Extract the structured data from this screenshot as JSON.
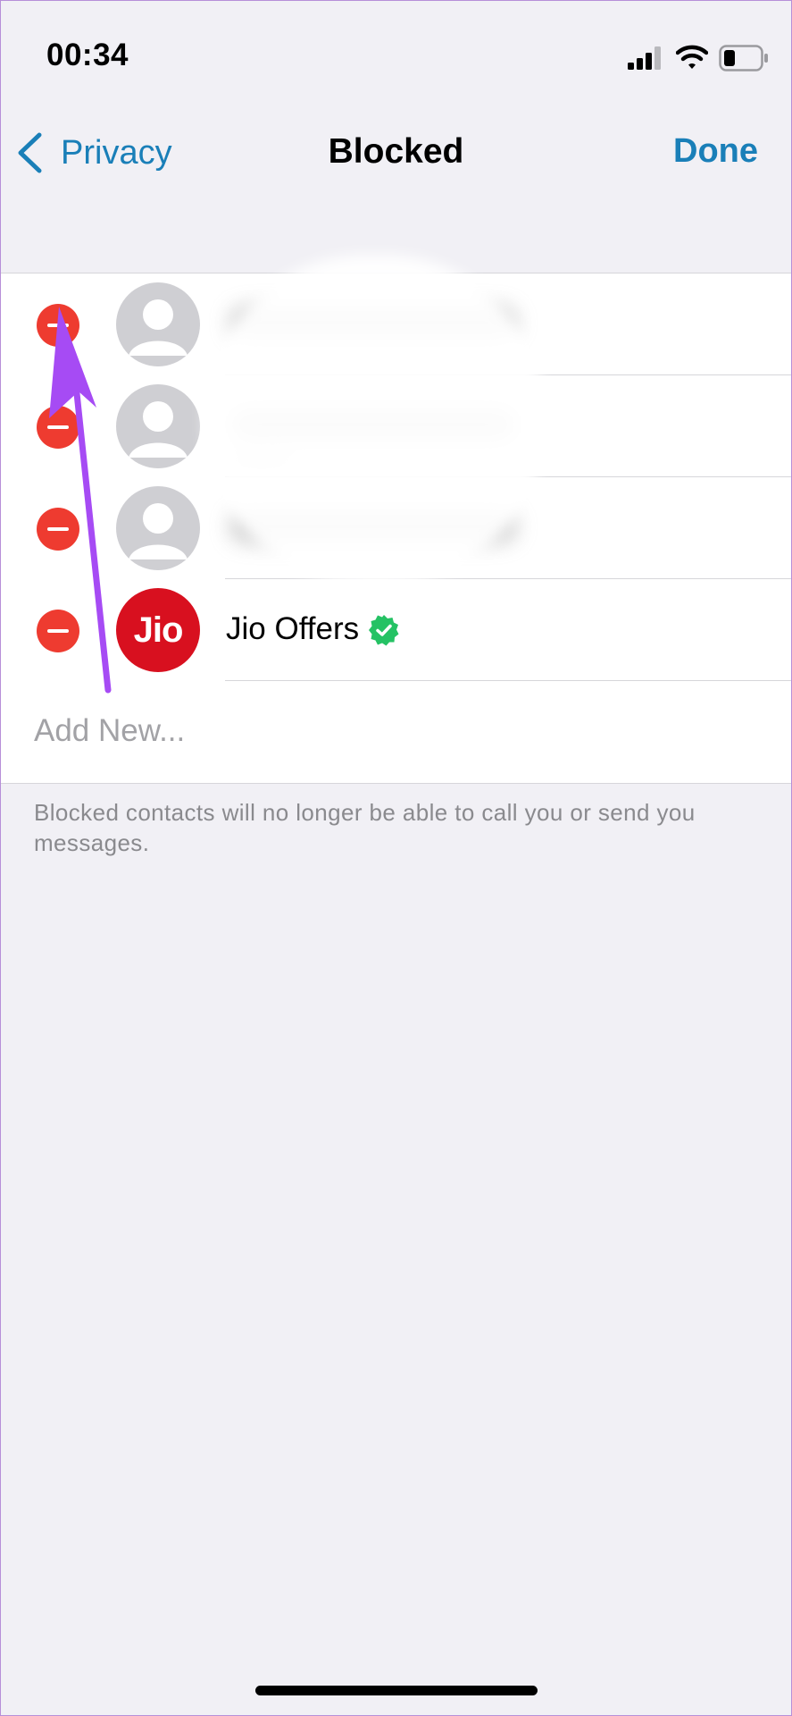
{
  "status_bar": {
    "time": "00:34"
  },
  "nav": {
    "back_label": "Privacy",
    "title": "Blocked",
    "done_label": "Done"
  },
  "contacts": [
    {
      "name": "",
      "redacted": true
    },
    {
      "name": "",
      "redacted": true
    },
    {
      "name": "",
      "redacted": true
    },
    {
      "name": "Jio Offers",
      "avatar_logo": "Jio",
      "verified": true
    }
  ],
  "add_new_label": "Add New...",
  "footer_note": "Blocked contacts will no longer be able to call you or send you messages.",
  "colors": {
    "accent": "#1a7fb8",
    "delete": "#ee3b30",
    "verified": "#25c264",
    "annotation": "#a64bf4",
    "background": "#f1f0f5"
  },
  "icons": [
    "back-chevron-icon",
    "signal-icon",
    "wifi-icon",
    "battery-icon",
    "delete-icon",
    "default-avatar-icon",
    "verified-icon",
    "annotation-arrow"
  ]
}
